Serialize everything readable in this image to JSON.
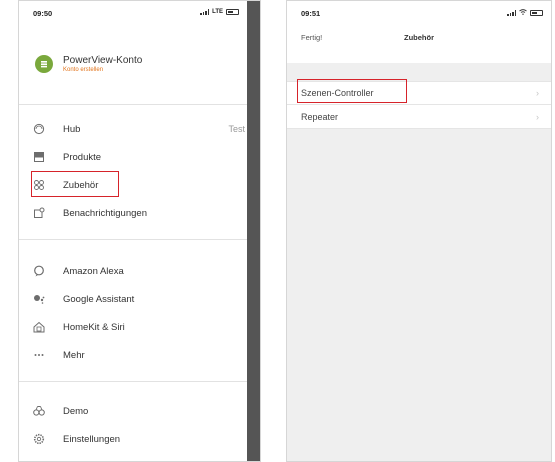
{
  "left_screen": {
    "status_bar": {
      "time": "09:50",
      "network": "LTE"
    },
    "account": {
      "title": "PowerView-Konto",
      "subtitle": "Konto erstellen"
    },
    "menu_group_1": [
      {
        "icon": "hub-icon",
        "label": "Hub",
        "value": "Test"
      },
      {
        "icon": "products-icon",
        "label": "Produkte"
      },
      {
        "icon": "accessories-icon",
        "label": "Zubehör"
      },
      {
        "icon": "notifications-icon",
        "label": "Benachrichtigungen"
      }
    ],
    "menu_group_2": [
      {
        "icon": "alexa-icon",
        "label": "Amazon Alexa"
      },
      {
        "icon": "google-assistant-icon",
        "label": "Google Assistant"
      },
      {
        "icon": "homekit-icon",
        "label": "HomeKit & Siri"
      },
      {
        "icon": "more-icon",
        "label": "Mehr"
      }
    ],
    "menu_group_3": [
      {
        "icon": "demo-icon",
        "label": "Demo"
      },
      {
        "icon": "settings-icon",
        "label": "Einstellungen"
      }
    ]
  },
  "right_screen": {
    "status_bar": {
      "time": "09:51"
    },
    "nav": {
      "done_label": "Fertig!",
      "title": "Zubehör"
    },
    "rows": [
      {
        "label": "Szenen-Controller"
      },
      {
        "label": "Repeater"
      }
    ]
  },
  "colors": {
    "highlight": "#d6232a",
    "brand_green": "#7aa83c",
    "accent_orange": "#e2741c"
  }
}
